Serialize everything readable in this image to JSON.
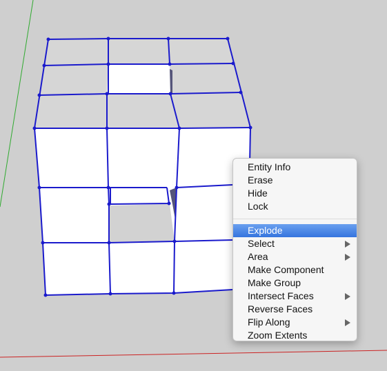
{
  "context_menu": {
    "group1": [
      {
        "label": "Entity Info",
        "submenu": false
      },
      {
        "label": "Erase",
        "submenu": false
      },
      {
        "label": "Hide",
        "submenu": false
      },
      {
        "label": "Lock",
        "submenu": false
      }
    ],
    "group2": [
      {
        "label": "Explode",
        "submenu": false,
        "highlighted": true
      },
      {
        "label": "Select",
        "submenu": true
      },
      {
        "label": "Area",
        "submenu": true
      },
      {
        "label": "Make Component",
        "submenu": false
      },
      {
        "label": "Make Group",
        "submenu": false
      },
      {
        "label": "Intersect Faces",
        "submenu": true
      },
      {
        "label": "Reverse Faces",
        "submenu": false
      },
      {
        "label": "Flip Along",
        "submenu": true
      },
      {
        "label": "Zoom Extents",
        "submenu": false
      }
    ]
  },
  "colors": {
    "viewport_bg": "#cfcfcf",
    "edge_selected": "#1a1acc",
    "face": "#ffffff",
    "axis_green": "#2faa2f",
    "axis_red": "#cc2222",
    "highlight": "#3574de"
  }
}
